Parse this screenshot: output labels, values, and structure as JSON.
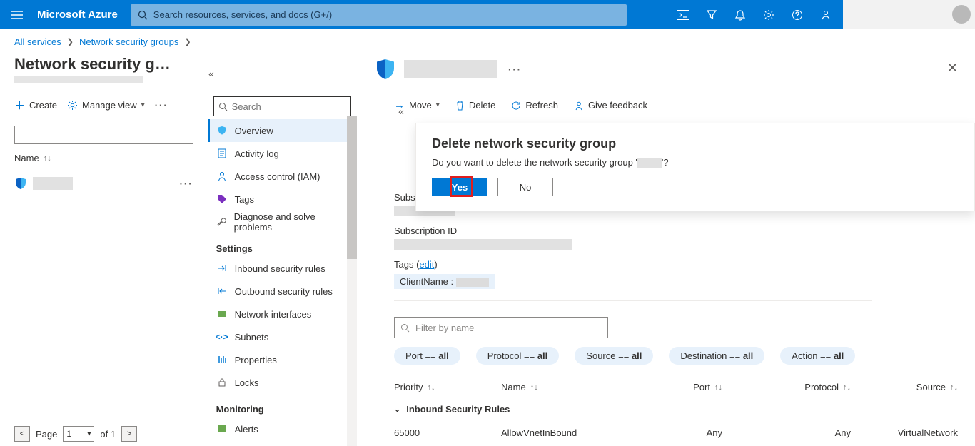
{
  "brand": "Microsoft Azure",
  "search_placeholder": "Search resources, services, and docs (G+/)",
  "breadcrumb": {
    "all": "All services",
    "nsg": "Network security groups"
  },
  "col1": {
    "title": "Network security g…",
    "create": "Create",
    "manage_view": "Manage view",
    "name_header": "Name",
    "page_label": "Page",
    "page_num": "1",
    "of": "of 1"
  },
  "nav": {
    "search_placeholder": "Search",
    "items": [
      "Overview",
      "Activity log",
      "Access control (IAM)",
      "Tags",
      "Diagnose and solve problems"
    ],
    "settings_title": "Settings",
    "settings_items": [
      "Inbound security rules",
      "Outbound security rules",
      "Network interfaces",
      "Subnets",
      "Properties",
      "Locks"
    ],
    "monitoring_title": "Monitoring",
    "monitoring_items": [
      "Alerts"
    ]
  },
  "actions": {
    "move": "Move",
    "delete": "Delete",
    "refresh": "Refresh",
    "feedback": "Give feedback"
  },
  "essentials": {
    "sub_label": "Subscription (",
    "subid_label": "Subscription ID",
    "tags_label": "Tags (",
    "edit": "edit",
    "tag_key": "ClientName :"
  },
  "filter_by_name": "Filter by name",
  "pills": {
    "port": "Port == ",
    "protocol": "Protocol == ",
    "source": "Source == ",
    "dest": "Destination == ",
    "action": "Action == ",
    "all": "all"
  },
  "table": {
    "headers": [
      "Priority",
      "Name",
      "Port",
      "Protocol",
      "Source"
    ],
    "group": "Inbound Security Rules",
    "row": {
      "priority": "65000",
      "name": "AllowVnetInBound",
      "port": "Any",
      "protocol": "Any",
      "source": "VirtualNetwork"
    }
  },
  "dialog": {
    "title": "Delete network security group",
    "text_a": "Do you want to delete the network security group '",
    "text_b": "'?",
    "yes": "Yes",
    "no": "No"
  }
}
